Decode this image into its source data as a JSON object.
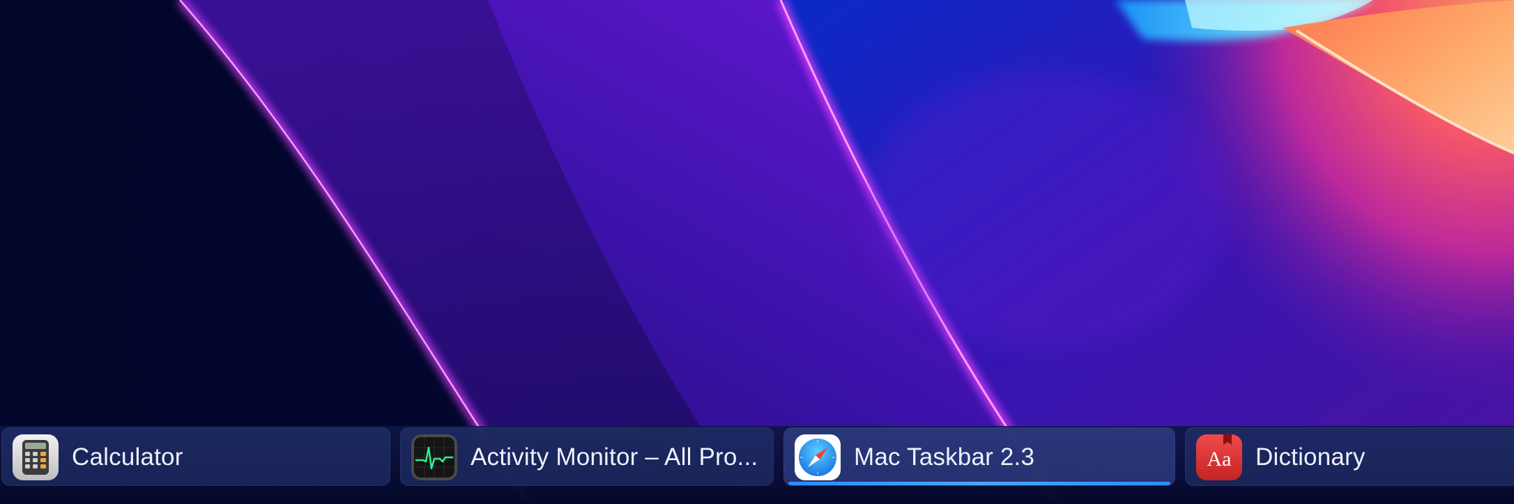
{
  "taskbar": {
    "tasks": [
      {
        "label": "Calculator",
        "icon": "calculator-icon",
        "active": false
      },
      {
        "label": "Activity Monitor – All Pro...",
        "icon": "activity-monitor-icon",
        "active": false
      },
      {
        "label": "Mac Taskbar 2.3",
        "icon": "safari-compass-icon",
        "active": true
      },
      {
        "label": "Dictionary",
        "icon": "dictionary-icon",
        "active": false
      }
    ]
  },
  "colors": {
    "wallpaper_dark": "#02062a",
    "wallpaper_purple": "#3b0fa0",
    "wallpaper_magenta": "#e03cff",
    "wallpaper_coral": "#ff5a6a",
    "active_indicator": "#2d8cff",
    "dictionary_red": "#e23a3a"
  }
}
